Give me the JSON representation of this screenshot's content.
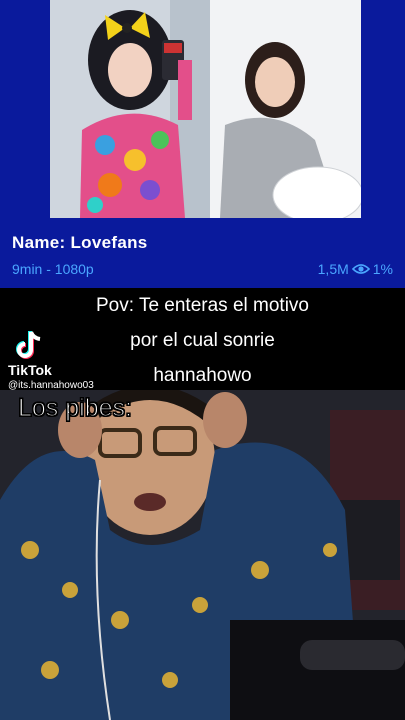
{
  "card": {
    "title": "Name: Lovefans",
    "meta_left": "9min - 1080p",
    "views": "1,5M",
    "percent": "1%",
    "icon": "eye-icon",
    "background": "#0a1a9c",
    "meta_color": "#4aa6ff"
  },
  "caption": {
    "line1": "Pov: Te enteras el motivo",
    "line2": "por el cual sonrie",
    "line3": "hannahowo"
  },
  "watermark": {
    "brand": "TikTok",
    "username": "@its.hannahowo03"
  },
  "video": {
    "overlay_text": "Los pibes:"
  }
}
